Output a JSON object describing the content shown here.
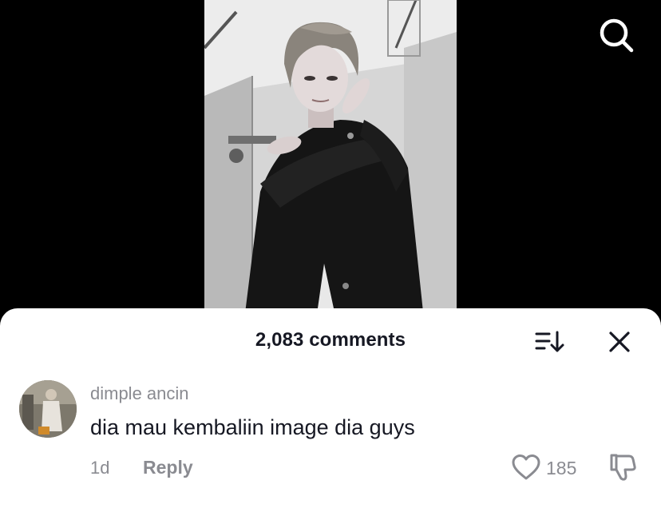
{
  "video": {
    "icon": "search-icon"
  },
  "comments_sheet": {
    "title": "2,083 comments",
    "sort_icon": "sort-icon",
    "close_icon": "close-icon"
  },
  "comment": {
    "username": "dimple ancin",
    "text": "dia mau kembaliin image dia guys",
    "time": "1d",
    "reply_label": "Reply",
    "like_count": "185"
  }
}
